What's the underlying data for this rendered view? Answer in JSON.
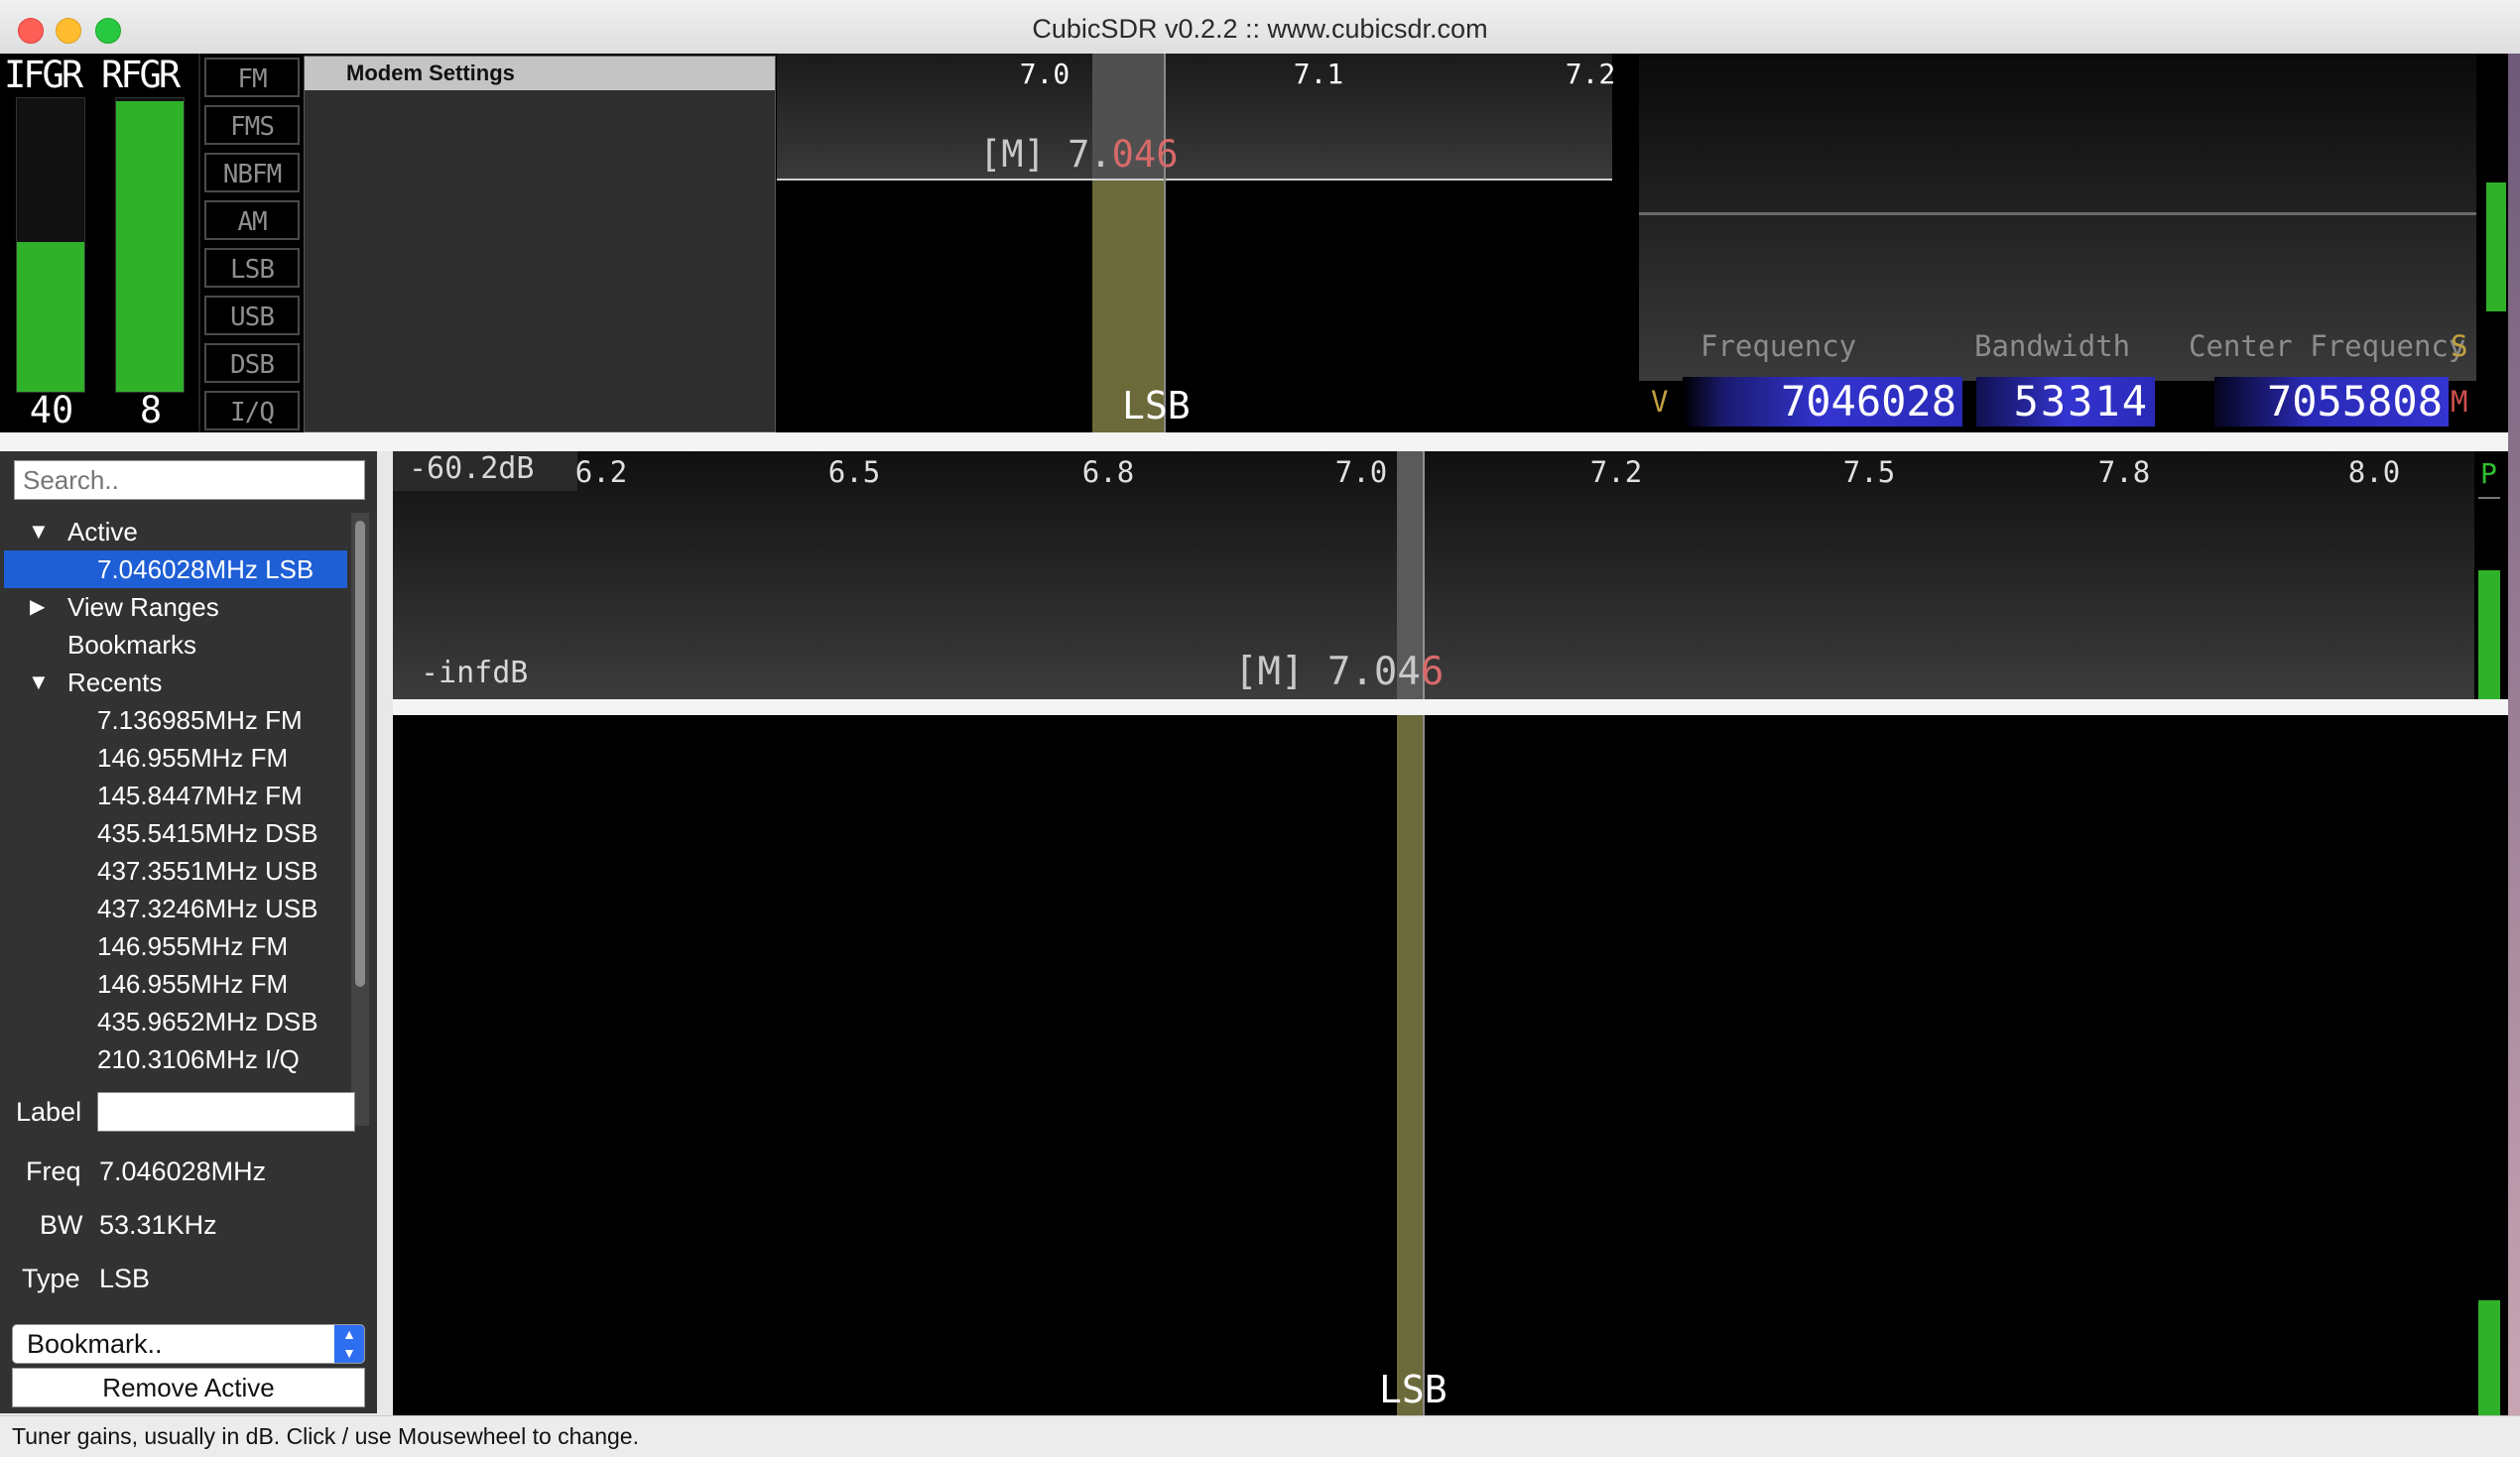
{
  "window": {
    "title": "CubicSDR v0.2.2 :: www.cubicsdr.com"
  },
  "gains": {
    "if_label": "IFGR",
    "if_value": "40",
    "if_fill": 0.51,
    "rf_label": "RFGR",
    "rf_value": "8",
    "rf_fill": 0.99
  },
  "modes": [
    "FM",
    "FMS",
    "NBFM",
    "AM",
    "LSB",
    "USB",
    "DSB",
    "I/Q"
  ],
  "modem": {
    "title": "Modem Settings"
  },
  "zoom_view": {
    "ticks": [
      "7.0",
      "7.1",
      "7.2"
    ],
    "marker_prefix": "[M] 7.",
    "marker_highlight": "046",
    "mode_label": "LSB"
  },
  "readout": {
    "freq_label": "Frequency",
    "bw_label": "Bandwidth",
    "center_label": "Center Frequency",
    "v_label": "V",
    "s_label": "S",
    "m_label": "M",
    "p_label": "P",
    "frequency": "7046028",
    "bandwidth": "53314",
    "center": "7055808"
  },
  "spectrum": {
    "db_top": "-60.2dB",
    "db_bottom": "-infdB",
    "ticks": [
      "6.2",
      "6.5",
      "6.8",
      "7.0",
      "7.2",
      "7.5",
      "7.8",
      "8.0"
    ],
    "marker_prefix": "[M] 7.04",
    "marker_highlight": "6"
  },
  "waterfall": {
    "mode_label": "LSB"
  },
  "bookmarks": {
    "search_placeholder": "Search..",
    "active_header": "Active",
    "active_item": "7.046028MHz LSB",
    "view_ranges": "View Ranges",
    "bookmarks_header": "Bookmarks",
    "recents_header": "Recents",
    "recents": [
      "7.136985MHz FM",
      "146.955MHz FM",
      "145.8447MHz FM",
      "435.5415MHz DSB",
      "437.3551MHz USB",
      "437.3246MHz USB",
      "146.955MHz FM",
      "146.955MHz FM",
      "435.9652MHz DSB",
      "210.3106MHz I/Q"
    ],
    "label_field": "Label",
    "label_value": "",
    "freq_field": "Freq",
    "freq_value": "7.046028MHz",
    "bw_field": "BW",
    "bw_value": "53.31KHz",
    "type_field": "Type",
    "type_value": "LSB",
    "bookmark_select": "Bookmark..",
    "remove_button": "Remove Active"
  },
  "status": {
    "text": "Tuner gains, usually in dB. Click / use Mousewheel to change."
  },
  "colors": {
    "accent_selection": "#1f5fd6",
    "meter_green": "#2fb12a",
    "demod_band": "#6b6a3a",
    "marker_red": "#d86a6a",
    "readout_blue": "#2a2ad0"
  }
}
